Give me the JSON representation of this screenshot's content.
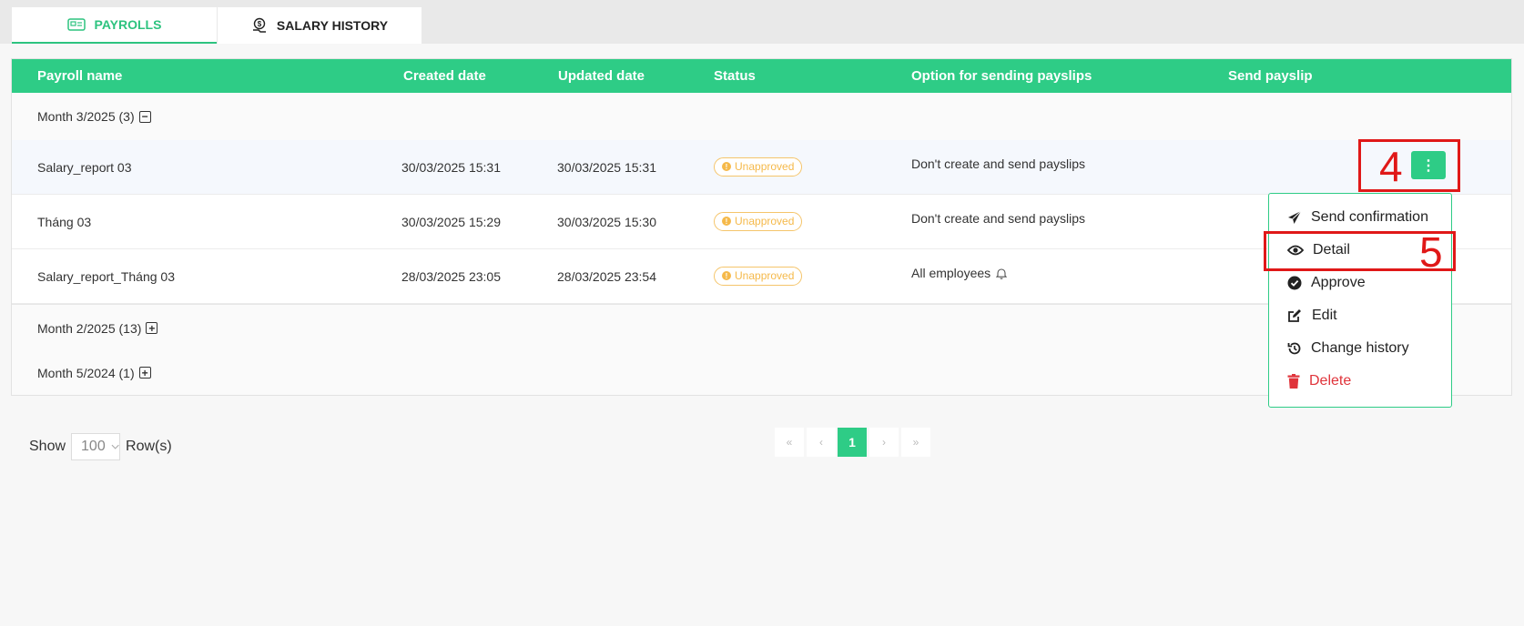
{
  "tabs": [
    {
      "label": "PAYROLLS",
      "icon": "payroll-card-icon",
      "active": true
    },
    {
      "label": "SALARY HISTORY",
      "icon": "salary-history-icon",
      "active": false
    }
  ],
  "table": {
    "columns": [
      "Payroll name",
      "Created date",
      "Updated date",
      "Status",
      "Option for sending payslips",
      "Send payslip"
    ],
    "groups": [
      {
        "label": "Month 3/2025 (3)",
        "toggle": "−",
        "rows": [
          {
            "name": "Salary_report 03",
            "created": "30/03/2025 15:31",
            "updated": "30/03/2025 15:31",
            "status": "Unapproved",
            "option": "Don't create and send payslips"
          },
          {
            "name": "Tháng 03",
            "created": "30/03/2025 15:29",
            "updated": "30/03/2025 15:30",
            "status": "Unapproved",
            "option": "Don't create and send payslips"
          },
          {
            "name": "Salary_report_Tháng 03",
            "created": "28/03/2025 23:05",
            "updated": "28/03/2025 23:54",
            "status": "Unapproved",
            "option": "All employees"
          }
        ]
      },
      {
        "label": "Month 2/2025 (13)",
        "toggle": "+"
      },
      {
        "label": "Month 5/2024 (1)",
        "toggle": "+"
      }
    ]
  },
  "actions_button": {
    "glyph": "⋮"
  },
  "menu": {
    "items": [
      {
        "label": "Send confirmation",
        "icon": "paper-plane-icon"
      },
      {
        "label": "Detail",
        "icon": "eye-icon"
      },
      {
        "label": "Approve",
        "icon": "check-circle-icon"
      },
      {
        "label": "Edit",
        "icon": "edit-icon"
      },
      {
        "label": "Change history",
        "icon": "history-icon"
      },
      {
        "label": "Delete",
        "icon": "trash-icon"
      }
    ]
  },
  "annotations": {
    "step4": "4",
    "step5": "5"
  },
  "footer": {
    "show_label": "Show",
    "rows_value": "100",
    "rows_label": "Row(s)"
  },
  "pagination": {
    "first": "«",
    "prev": "‹",
    "current": "1",
    "next": "›",
    "last": "»"
  },
  "colors": {
    "accent": "#2ecc86",
    "warning": "#f5b94a",
    "danger": "#e0343b",
    "annotation": "#e01818"
  }
}
